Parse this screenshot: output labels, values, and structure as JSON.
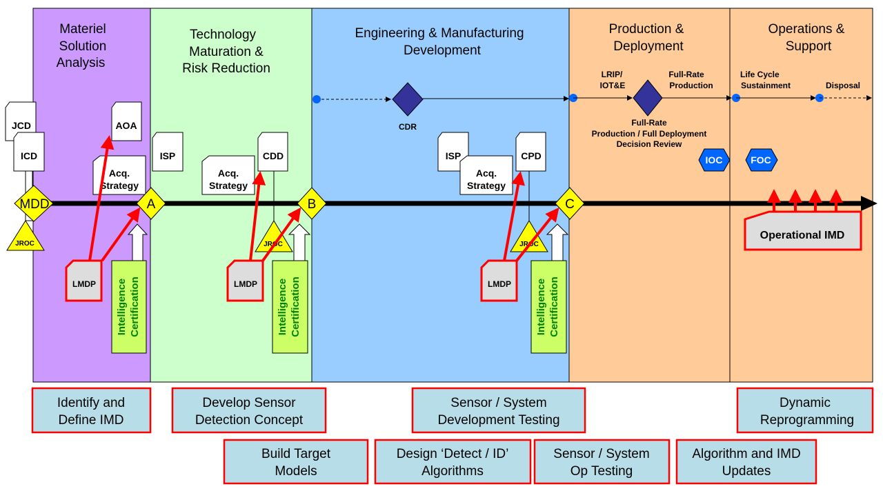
{
  "colors": {
    "phase1": "#cc99ff",
    "phase2": "#ccffcc",
    "phase3": "#99ccff",
    "phase4": "#ffcc99",
    "phase5": "#ffcc99",
    "milestone": "#ffff00",
    "decision": "#333399",
    "status_hex": "#0066ff",
    "activity_fill": "#b7dde8",
    "activity_border": "#ff0000",
    "cert_fill": "#ccff66",
    "cert_text": "#008000",
    "lmdp_fill": "#dddddd"
  },
  "phases": [
    {
      "lines": [
        "Materiel",
        "Solution",
        "Analysis"
      ]
    },
    {
      "lines": [
        "Technology",
        "Maturation &",
        "Risk Reduction"
      ]
    },
    {
      "lines": [
        "Engineering & Manufacturing",
        "Development"
      ]
    },
    {
      "lines": [
        "Production &",
        "Deployment"
      ]
    },
    {
      "lines": [
        "Operations &",
        "Support"
      ]
    }
  ],
  "milestones": {
    "mdd": "MDD",
    "a": "A",
    "b": "B",
    "c": "C"
  },
  "jroc": "JROC",
  "documents": {
    "jcd": "JCD",
    "icd": "ICD",
    "aoa": "AOA",
    "isp": "ISP",
    "cdd": "CDD",
    "cpd": "CPD",
    "acq": [
      "Acq.",
      "Strategy"
    ]
  },
  "lmdp": "LMDP",
  "intel_cert": [
    "Intelligence",
    "Certification"
  ],
  "top_flow": {
    "cdr": "CDR",
    "lrip": [
      "LRIP/",
      "IOT&E"
    ],
    "frp": [
      "Full-Rate",
      "Production"
    ],
    "frp_review": [
      "Full-Rate",
      "Production / Full Deployment",
      "Decision Review"
    ],
    "lcs": [
      "Life Cycle",
      "Sustainment"
    ],
    "disposal": "Disposal",
    "ioc": "IOC",
    "foc": "FOC"
  },
  "operational_imd": "Operational IMD",
  "activities": [
    {
      "lines": [
        "Identify and",
        "Define IMD"
      ]
    },
    {
      "lines": [
        "Develop Sensor",
        "Detection Concept"
      ]
    },
    {
      "lines": [
        "Sensor / System",
        "Development Testing"
      ]
    },
    {
      "lines": [
        "Dynamic",
        "Reprogramming"
      ]
    },
    {
      "lines": [
        "Build Target",
        "Models"
      ]
    },
    {
      "lines": [
        "Design ‘Detect / ID’",
        "Algorithms"
      ]
    },
    {
      "lines": [
        "Sensor / System",
        "Op Testing"
      ]
    },
    {
      "lines": [
        "Algorithm  and IMD",
        "Updates"
      ]
    }
  ]
}
